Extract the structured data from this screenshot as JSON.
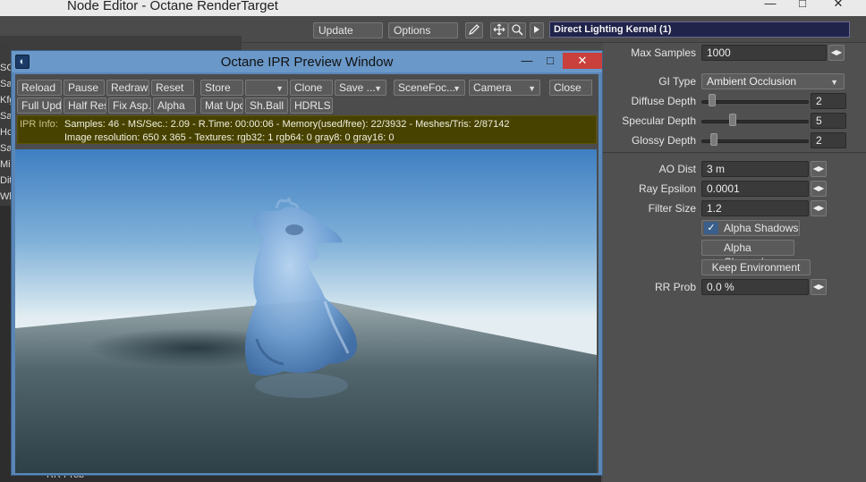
{
  "node_editor": {
    "title": "Node Editor - Octane RenderTarget",
    "window_buttons": [
      "—",
      "□",
      "✕"
    ],
    "toolbar": {
      "update_label": "Update",
      "options_label": "Options",
      "kernel_value": "Direct Lighting Kernel (1)"
    },
    "left_strip_letters": [
      "ss",
      "SC",
      "Sa",
      "Kfg",
      "Sa",
      "Ho",
      "Sa",
      "Mir",
      "Dit",
      "Wh",
      "Wh"
    ],
    "bottom_strip_text": "RR Prob"
  },
  "properties": {
    "max_samples_label": "Max Samples",
    "max_samples_value": "1000",
    "gi_type_label": "GI Type",
    "gi_type_value": "Ambient Occlusion",
    "diffuse_depth_label": "Diffuse Depth",
    "diffuse_depth_value": "2",
    "specular_depth_label": "Specular Depth",
    "specular_depth_value": "5",
    "glossy_depth_label": "Glossy Depth",
    "glossy_depth_value": "2",
    "ao_dist_label": "AO Dist",
    "ao_dist_value": "3 m",
    "ray_epsilon_label": "Ray Epsilon",
    "ray_epsilon_value": "0.0001",
    "filter_size_label": "Filter Size",
    "filter_size_value": "1.2",
    "alpha_shadows_label": "Alpha Shadows",
    "alpha_shadows_checked": true,
    "alpha_channel_label": "Alpha Channel",
    "keep_environment_label": "Keep Environment",
    "rr_prob_label": "RR Prob",
    "rr_prob_value": "0.0 %"
  },
  "ipr": {
    "title": "Octane IPR Preview Window",
    "row1": [
      "Reload",
      "Pause",
      "Redraw",
      "Reset",
      "Store",
      "",
      "Clone",
      "Save ...",
      "SceneFoc...",
      "Camera",
      "Close"
    ],
    "row2": [
      "Full Upd.",
      "Half Res",
      "Fix Asp.",
      "Alpha",
      "Mat Upd",
      "Sh.Ball",
      "HDRLS"
    ],
    "info_label": "IPR Info:",
    "info_line1": "Samples: 46  -  MS/Sec.: 2.09  -  R.Time: 00:00:06 - Memory(used/free): 22/3932  -  Meshes/Tris: 2/87142",
    "info_line2": "Image resolution: 650 x 365 - Textures:  rgb32: 1   rgb64: 0   gray8: 0   gray16: 0"
  },
  "colors": {
    "panel_bg": "#505050",
    "kernel_bg": "#20234a",
    "ipr_frame": "#5a86b6",
    "info_bar": "#484200",
    "close_red": "#c9403c"
  }
}
